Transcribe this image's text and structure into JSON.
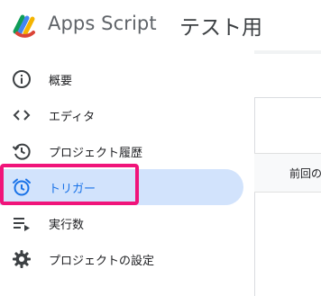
{
  "header": {
    "app_title": "Apps Script",
    "project_title": "テスト用",
    "logo_icon": "apps-script-logo-icon"
  },
  "sidebar": {
    "items": [
      {
        "label": "概要",
        "icon": "info-icon",
        "active": false
      },
      {
        "label": "エディタ",
        "icon": "code-icon",
        "active": false
      },
      {
        "label": "プロジェクト履歴",
        "icon": "history-icon",
        "active": false
      },
      {
        "label": "トリガー",
        "icon": "alarm-clock-icon",
        "active": true
      },
      {
        "label": "実行数",
        "icon": "executions-list-icon",
        "active": false
      },
      {
        "label": "プロジェクトの設定",
        "icon": "gear-icon",
        "active": false
      }
    ]
  },
  "table": {
    "column_header": "前回の"
  },
  "colors": {
    "accent": "#1a73e8",
    "active_bg": "#d2e3fc",
    "highlight_annotation": "#f0147a"
  }
}
